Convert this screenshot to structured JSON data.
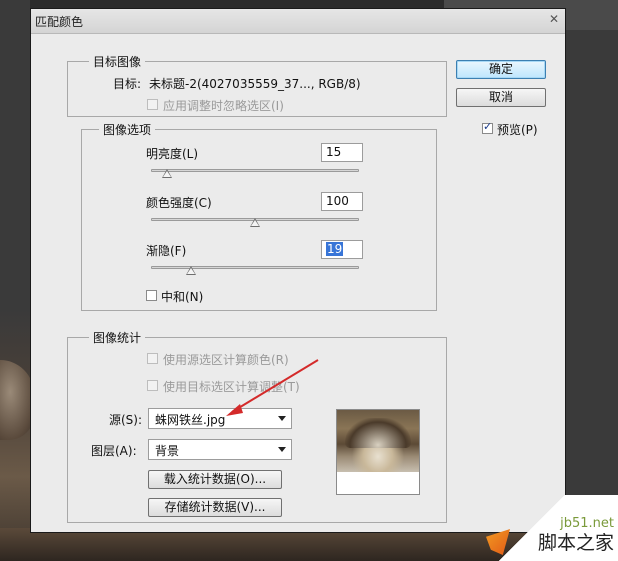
{
  "dialog": {
    "title": "匹配颜色"
  },
  "target_group": {
    "label": "目标图像",
    "target_label": "目标:",
    "target_value": "未标题-2(4027035559_37..., RGB/8)",
    "ignore_selection_label": "应用调整时忽略选区(I)",
    "ignore_selection_checked": false
  },
  "image_options": {
    "label": "图像选项",
    "luminance": {
      "label": "明亮度(L)",
      "value": "15",
      "level": 15,
      "max": 200
    },
    "color_intensity": {
      "label": "颜色强度(C)",
      "value": "100",
      "level": 100,
      "max": 200
    },
    "fade": {
      "label": "渐隐(F)",
      "value": "19",
      "level": 19,
      "max": 100
    },
    "neutralize_label": "中和(N)",
    "neutralize_checked": false
  },
  "image_stats": {
    "label": "图像统计",
    "use_source_selection_label": "使用源选区计算颜色(R)",
    "use_target_selection_label": "使用目标选区计算调整(T)",
    "source_label": "源(S):",
    "source_value": "蛛网铁丝.jpg",
    "layer_label": "图层(A):",
    "layer_value": "背景",
    "load_stats_label": "载入统计数据(O)...",
    "save_stats_label": "存储统计数据(V)..."
  },
  "buttons": {
    "ok_label": "确定",
    "cancel_label": "取消"
  },
  "preview": {
    "label": "预览(P)",
    "checked": true
  },
  "watermark": {
    "url": "jb51.net",
    "name": "脚本之家"
  },
  "colors": {
    "accent": "#3875d7",
    "arrow": "#d42a2a",
    "dialog_bg": "#ebebeb"
  }
}
